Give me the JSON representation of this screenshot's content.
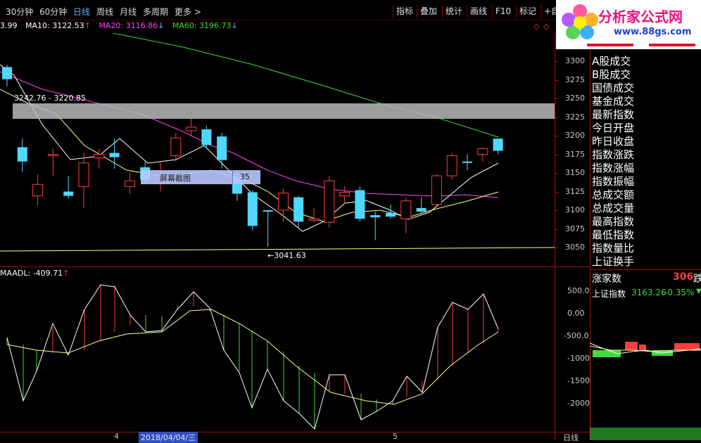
{
  "toolbar": {
    "items": [
      "30分钟",
      "60分钟",
      "日线",
      "周线",
      "月线",
      "多周期",
      "更多 >"
    ],
    "active_index": 2,
    "buttons": [
      "指标",
      "叠加",
      "统计",
      "画线",
      "F10",
      "标记",
      "+自选"
    ]
  },
  "logo": {
    "title": "分析家公式网",
    "url": "www.88gs.com"
  },
  "ma_row": {
    "prefix": "3.99",
    "ma10": "MA10: 3122.53",
    "ma20": "MA20: 3116.86",
    "ma60": "MA60: 3196.73"
  },
  "price_axis": {
    "ticks": [
      "3300",
      "3275",
      "3250",
      "3225",
      "3200",
      "3175",
      "3150",
      "3125",
      "3100",
      "3075",
      "3050"
    ]
  },
  "price_chart": {
    "range_label": "3242.76 - 3220.85",
    "low_label": "3041.63",
    "screenshot_tip": "屏幕截图",
    "screenshot_num": "35"
  },
  "right_panel": {
    "items": [
      "A股成交",
      "B股成交",
      "国债成交",
      "基金成交",
      "最新指数",
      "今日开盘",
      "昨日收盘",
      "指数涨跌",
      "指数涨幅",
      "指数振幅",
      "总成交额",
      "总成交量",
      "最高指数",
      "最低指数",
      "指数量比",
      "上证换手"
    ],
    "rise_label": "涨家数",
    "rise_value": "306",
    "rise_suffix": "跌",
    "index_name": "上证指数",
    "index_value": "3163.26",
    "index_change": "-0.35%"
  },
  "indicator": {
    "label": "MAADL: -409.71",
    "ticks": [
      "500.0",
      "0.00",
      "-500.0",
      "-1000",
      "-1500",
      "-2000"
    ]
  },
  "bottom": {
    "date_marker_left": "4",
    "date_label": "2018/04/04/三",
    "date_marker_right": "5",
    "period_label": "日线"
  },
  "chart_data": {
    "type": "candlestick",
    "ylim": [
      3030,
      3310
    ],
    "candles": [
      {
        "o": 3275,
        "c": 3292,
        "h": 3295,
        "l": 3265,
        "up": false
      },
      {
        "o": 3180,
        "c": 3160,
        "h": 3192,
        "l": 3145,
        "up": false
      },
      {
        "o": 3112,
        "c": 3128,
        "h": 3142,
        "l": 3098,
        "up": true
      },
      {
        "o": 3168,
        "c": 3170,
        "h": 3178,
        "l": 3140,
        "up": true
      },
      {
        "o": 3118,
        "c": 3112,
        "h": 3140,
        "l": 3108,
        "up": false
      },
      {
        "o": 3125,
        "c": 3158,
        "h": 3172,
        "l": 3095,
        "up": true
      },
      {
        "o": 3165,
        "c": 3170,
        "h": 3178,
        "l": 3150,
        "up": true
      },
      {
        "o": 3172,
        "c": 3166,
        "h": 3192,
        "l": 3150,
        "up": false
      },
      {
        "o": 3125,
        "c": 3133,
        "h": 3145,
        "l": 3115,
        "up": true
      },
      {
        "o": 3152,
        "c": 3135,
        "h": 3160,
        "l": 3128,
        "up": false
      },
      {
        "o": 3130,
        "c": 3140,
        "h": 3160,
        "l": 3118,
        "up": true
      },
      {
        "o": 3168,
        "c": 3193,
        "h": 3200,
        "l": 3160,
        "up": true
      },
      {
        "o": 3203,
        "c": 3208,
        "h": 3220,
        "l": 3195,
        "up": true
      },
      {
        "o": 3205,
        "c": 3183,
        "h": 3210,
        "l": 3178,
        "up": false
      },
      {
        "o": 3195,
        "c": 3162,
        "h": 3200,
        "l": 3150,
        "up": false
      },
      {
        "o": 3137,
        "c": 3115,
        "h": 3148,
        "l": 3105,
        "up": false
      },
      {
        "o": 3117,
        "c": 3070,
        "h": 3120,
        "l": 3063,
        "up": false
      },
      {
        "o": 3090,
        "c": 3092,
        "h": 3090,
        "l": 3041,
        "up": false
      },
      {
        "o": 3092,
        "c": 3116,
        "h": 3122,
        "l": 3075,
        "up": true
      },
      {
        "o": 3110,
        "c": 3076,
        "h": 3112,
        "l": 3068,
        "up": false
      },
      {
        "o": 3078,
        "c": 3080,
        "h": 3095,
        "l": 3075,
        "up": true
      },
      {
        "o": 3075,
        "c": 3133,
        "h": 3140,
        "l": 3068,
        "up": true
      },
      {
        "o": 3112,
        "c": 3117,
        "h": 3125,
        "l": 3100,
        "up": true
      },
      {
        "o": 3120,
        "c": 3080,
        "h": 3125,
        "l": 3076,
        "up": false
      },
      {
        "o": 3085,
        "c": 3082,
        "h": 3090,
        "l": 3050,
        "up": false
      },
      {
        "o": 3083,
        "c": 3088,
        "h": 3100,
        "l": 3080,
        "up": false
      },
      {
        "o": 3080,
        "c": 3105,
        "h": 3110,
        "l": 3060,
        "up": true
      },
      {
        "o": 3090,
        "c": 3095,
        "h": 3110,
        "l": 3088,
        "up": false
      },
      {
        "o": 3100,
        "c": 3140,
        "h": 3142,
        "l": 3098,
        "up": true
      },
      {
        "o": 3140,
        "c": 3168,
        "h": 3172,
        "l": 3135,
        "up": true
      },
      {
        "o": 3158,
        "c": 3160,
        "h": 3170,
        "l": 3148,
        "up": false
      },
      {
        "o": 3170,
        "c": 3178,
        "h": 3180,
        "l": 3160,
        "up": true
      },
      {
        "o": 3175,
        "c": 3192,
        "h": 3192,
        "l": 3170,
        "up": false
      }
    ]
  }
}
